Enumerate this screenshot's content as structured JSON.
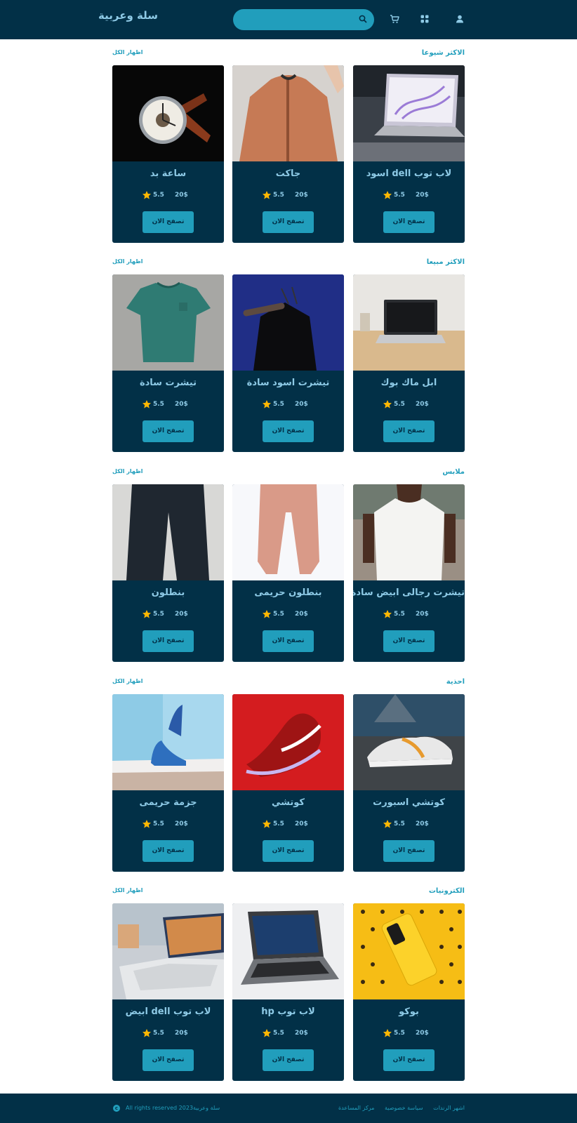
{
  "header": {
    "brand": "سلة وعربية",
    "search_placeholder": "",
    "icons": [
      "user-icon",
      "grid-icon",
      "cart-icon",
      "search-icon"
    ]
  },
  "colors": {
    "primary": "#023047",
    "accent": "#219ebc",
    "light": "#8ecae6",
    "star": "#ffb703"
  },
  "sections": [
    {
      "title": "الاكثر شيوعا",
      "link": "اظهار الكل",
      "products": [
        {
          "name": "لاب توب dell اسود",
          "price": "20$",
          "rating": "5.5",
          "button": "تصفح الان",
          "image": "laptop-dark"
        },
        {
          "name": "جاكت",
          "price": "20$",
          "rating": "5.5",
          "button": "تصفح الان",
          "image": "jacket"
        },
        {
          "name": "ساعة بد",
          "price": "20$",
          "rating": "5.5",
          "button": "تصفح الان",
          "image": "watch"
        }
      ]
    },
    {
      "title": "الاكثر مبيعا",
      "link": "اظهار الكل",
      "products": [
        {
          "name": "ابل ماك بوك",
          "price": "20$",
          "rating": "5.5",
          "button": "تصفح الان",
          "image": "macbook"
        },
        {
          "name": "تيشرت اسود سادة",
          "price": "20$",
          "rating": "5.5",
          "button": "تصفح الان",
          "image": "black-shirt"
        },
        {
          "name": "تيشرت سادة",
          "price": "20$",
          "rating": "5.5",
          "button": "تصفح الان",
          "image": "green-shirt"
        }
      ]
    },
    {
      "title": "ملابس",
      "link": "اظهار الكل",
      "products": [
        {
          "name": "تيشرت رجالى ابيض سادة",
          "price": "20$",
          "rating": "5.5",
          "button": "تصفح الان",
          "image": "white-shirt"
        },
        {
          "name": "بنطلون حريمى",
          "price": "20$",
          "rating": "5.5",
          "button": "تصفح الان",
          "image": "pink-pants"
        },
        {
          "name": "بنطلون",
          "price": "20$",
          "rating": "5.5",
          "button": "تصفح الان",
          "image": "dark-pants"
        }
      ]
    },
    {
      "title": "احذية",
      "link": "اظهار الكل",
      "products": [
        {
          "name": "كوتشي اسبورت",
          "price": "20$",
          "rating": "5.5",
          "button": "تصفح الان",
          "image": "sport-shoe"
        },
        {
          "name": "كوتشي",
          "price": "20$",
          "rating": "5.5",
          "button": "تصفح الان",
          "image": "red-shoe"
        },
        {
          "name": "جزمة حريمى",
          "price": "20$",
          "rating": "5.5",
          "button": "تصفح الان",
          "image": "heels"
        }
      ]
    },
    {
      "title": "الكترونيات",
      "link": "اظهار الكل",
      "products": [
        {
          "name": "بوكو",
          "price": "20$",
          "rating": "5.5",
          "button": "تصفح الان",
          "image": "poco-phone"
        },
        {
          "name": "لاب توب hp",
          "price": "20$",
          "rating": "5.5",
          "button": "تصفح الان",
          "image": "hp-laptop"
        },
        {
          "name": "لاب توب dell ابيض",
          "price": "20$",
          "rating": "5.5",
          "button": "تصفح الان",
          "image": "white-laptop"
        }
      ]
    }
  ],
  "footer": {
    "copyright": "All rights reserved سلة وعربية2023",
    "copyright_icon": "c",
    "links": [
      "اشهر الرندات",
      "سياسة خصوصية",
      "مركز المساعدة"
    ]
  }
}
